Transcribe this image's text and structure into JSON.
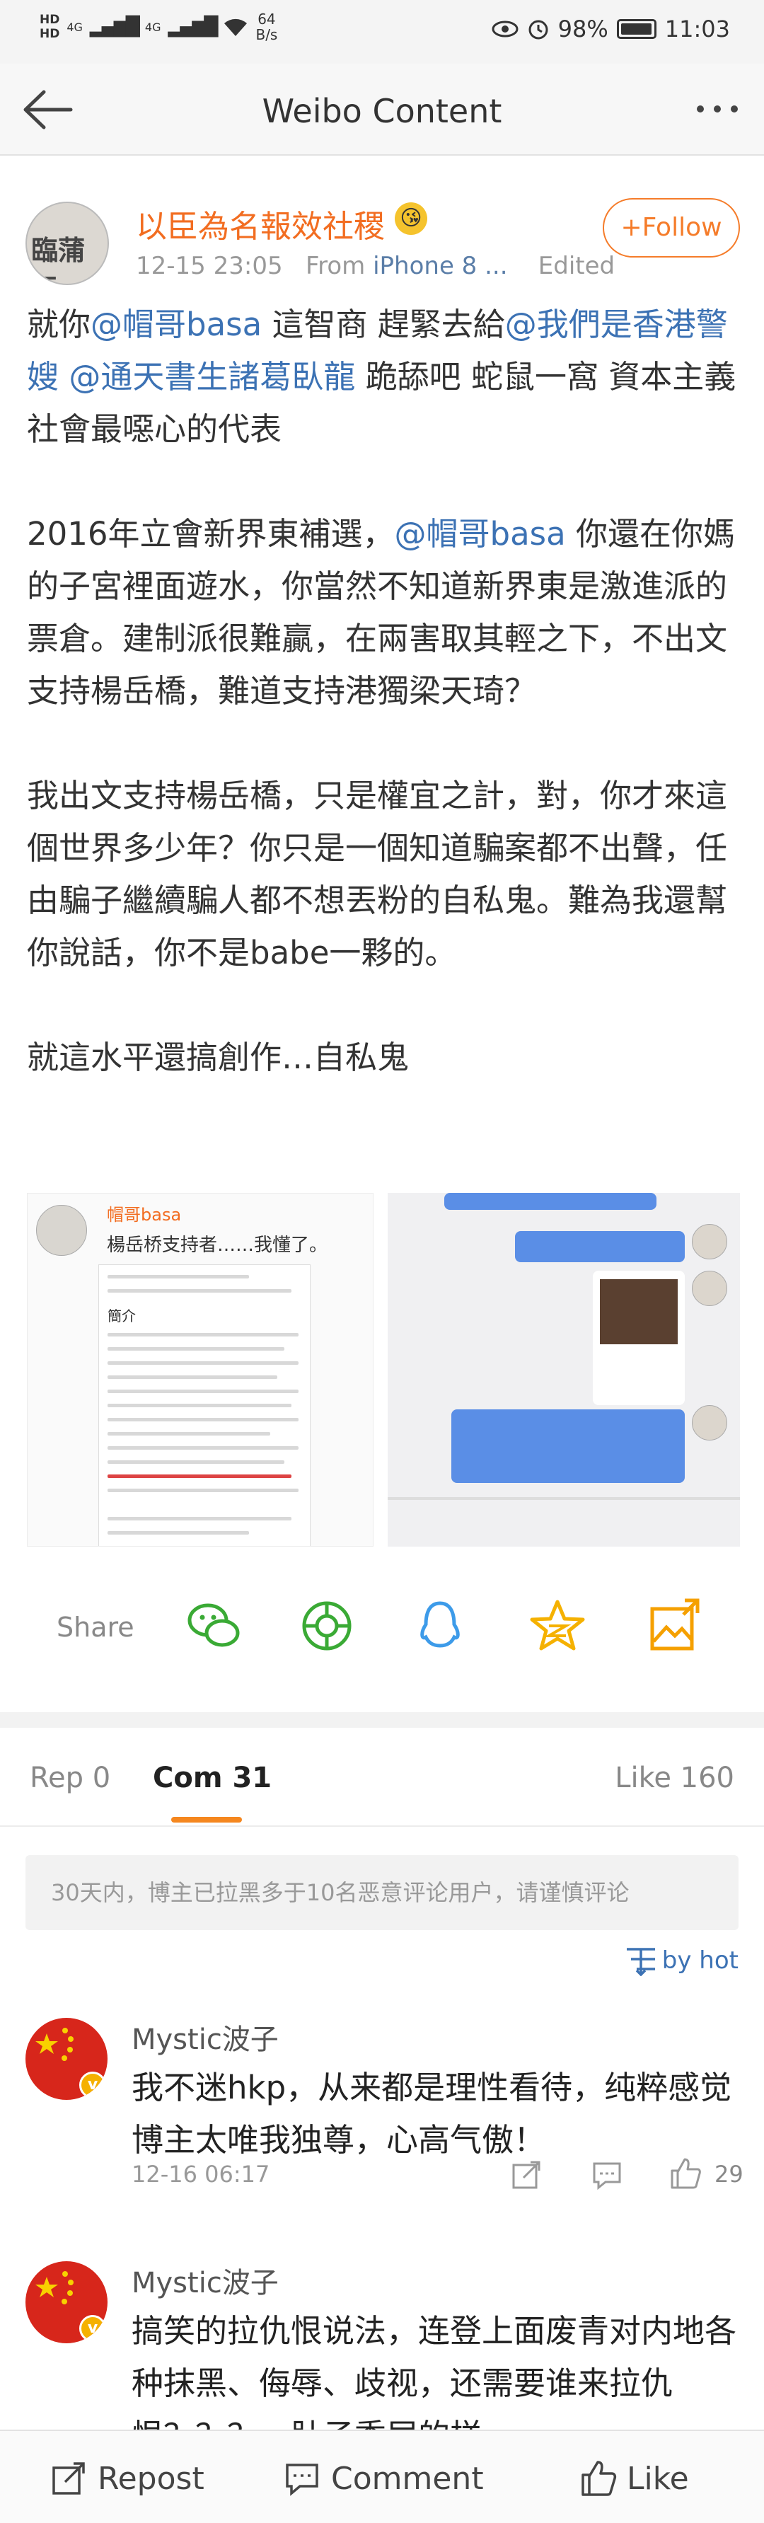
{
  "status_bar": {
    "hd1": "HD",
    "hd2": "HD",
    "net1": "4G",
    "net2": "4G",
    "speed_value": "64",
    "speed_unit": "B/s",
    "battery": "98%",
    "time": "11:03"
  },
  "navbar": {
    "title": "Weibo Content"
  },
  "post": {
    "author_avatar_text": "臨蒲臣",
    "author_name": "以臣為名報效社稷",
    "author_badge": "😘",
    "time": "12-15 23:05",
    "from_label": "From",
    "device": "iPhone 8 ...",
    "edited": "Edited",
    "follow_label": "Follow",
    "paragraphs": [
      [
        {
          "t": "就你",
          "m": false
        },
        {
          "t": "@帽哥basa",
          "m": true
        },
        {
          "t": " 這智商 趕緊去給",
          "m": false
        },
        {
          "t": "@我們是香港警嫂",
          "m": true
        },
        {
          "t": " ",
          "m": false
        },
        {
          "t": "@通天書生諸葛臥龍",
          "m": true
        },
        {
          "t": " 跪舔吧 蛇鼠一窩 資本主義社會最噁心的代表",
          "m": false
        }
      ],
      [
        {
          "t": "2016年立會新界東補選，",
          "m": false
        },
        {
          "t": "@帽哥basa",
          "m": true
        },
        {
          "t": " 你還在你媽的子宮裡面遊水，你當然不知道新界東是激進派的票倉。建制派很難贏，在兩害取其輕之下，不出文支持楊岳橋，難道支持港獨梁天琦？",
          "m": false
        }
      ],
      [
        {
          "t": "我出文支持楊岳橋，只是權宜之計，對，你才來這個世界多少年？你只是一個知道騙案都不出聲，任由騙子繼續騙人都不想丟粉的自私鬼。難為我還幫你說話，你不是babe一夥的。",
          "m": false
        }
      ],
      [
        {
          "t": "就這水平還搞創作…自私鬼",
          "m": false
        }
      ]
    ]
  },
  "images": {
    "left_name": "帽哥basa",
    "left_caption": "楊岳桥支持者……我懂了。",
    "left_doc_title": "簡介"
  },
  "share": {
    "label": "Share",
    "targets": [
      "wechat-icon",
      "moments-icon",
      "qq-icon",
      "qzone-icon",
      "save-image-icon"
    ],
    "colors": [
      "#3aaa35",
      "#3aaa35",
      "#3d9be9",
      "#f5b100",
      "#f5a000"
    ]
  },
  "tabs": {
    "repost": "Rep 0",
    "comments": "Com 31",
    "likes": "Like 160"
  },
  "notice": "30天内，博主已拉黑多于10名恶意评论用户，请谨慎评论",
  "sort_label": "by hot",
  "comments": [
    {
      "name": "Mystic波子",
      "text": "我不迷hkp，从来都是理性看待，纯粹感觉博主太唯我独尊，心高气傲！",
      "time": "12-16 06:17",
      "likes": "29"
    },
    {
      "name": "Mystic波子",
      "text": "搞笑的拉仇恨说法，连登上面废青对内地各种抹黑、侮辱、歧视，还需要谁来拉仇恨？？？一肚子委屈的样"
    }
  ],
  "bottom_bar": {
    "repost": "Repost",
    "comment": "Comment",
    "like": "Like"
  },
  "accent": "#f5871f",
  "link_color": "#3c72b4"
}
